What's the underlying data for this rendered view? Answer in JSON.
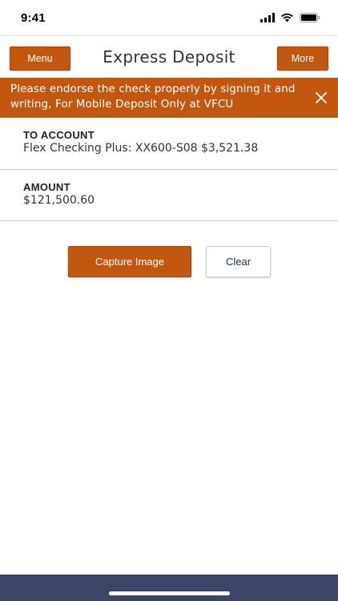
{
  "status_bar": {
    "time": "9:41",
    "icons": [
      "cellular-signal-icon",
      "wifi-icon",
      "battery-icon"
    ]
  },
  "header": {
    "menu_label": "Menu",
    "title": "Express Deposit",
    "more_label": "More"
  },
  "banner": {
    "message": "Please endorse the check properly by signing it and writing, For Mobile Deposit Only at VFCU",
    "close_icon": "close-icon"
  },
  "to_account": {
    "label": "TO ACCOUNT",
    "value": "Flex Checking Plus: XX600-S08 $3,521.38"
  },
  "amount": {
    "label": "AMOUNT",
    "value": "$121,500.60"
  },
  "actions": {
    "capture_label": "Capture Image",
    "clear_label": "Clear"
  },
  "colors": {
    "accent": "#c2570f",
    "bottom_bar": "#3a4466",
    "clear_text": "#1c2d5a"
  }
}
